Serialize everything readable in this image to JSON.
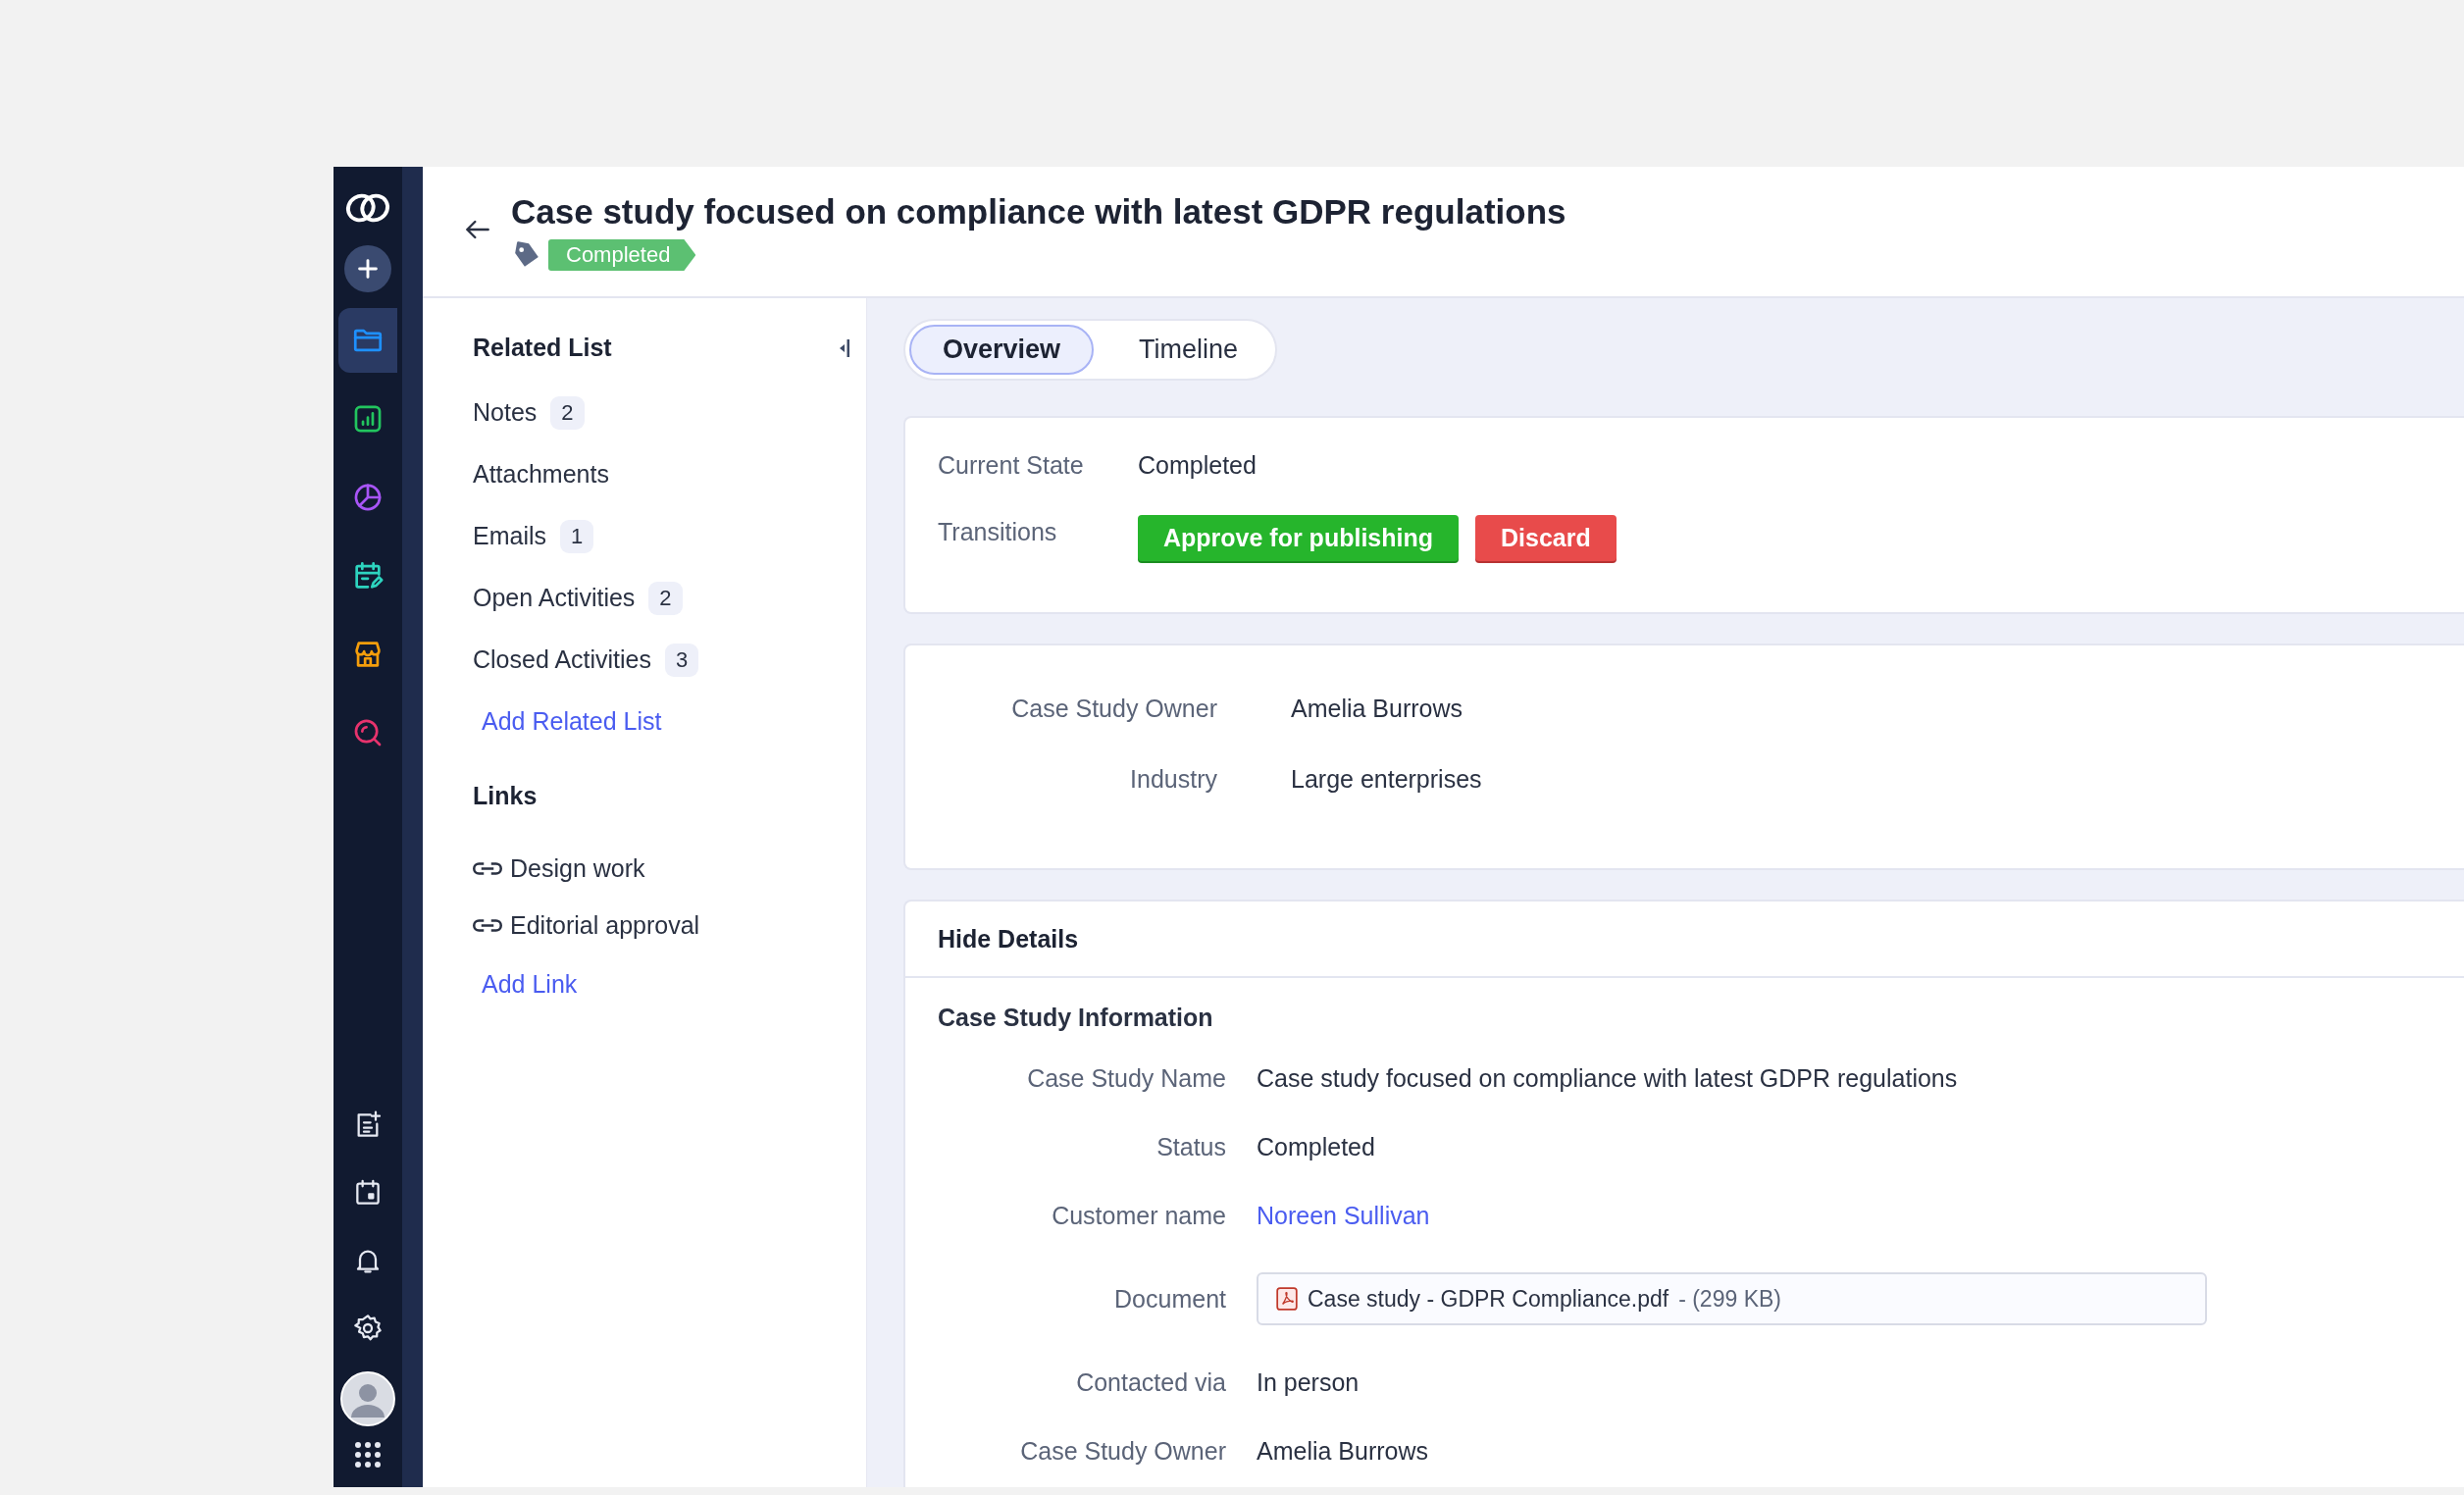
{
  "sidebar": {
    "top_items": [
      {
        "kind": "folder",
        "selected": true
      },
      {
        "kind": "chart",
        "selected": false
      },
      {
        "kind": "pie",
        "selected": false
      },
      {
        "kind": "calendar-edit",
        "selected": false
      },
      {
        "kind": "store",
        "selected": false
      },
      {
        "kind": "search",
        "selected": false
      }
    ],
    "bottom_items": [
      {
        "kind": "note-add"
      },
      {
        "kind": "calendar"
      },
      {
        "kind": "bell"
      },
      {
        "kind": "gear"
      }
    ]
  },
  "header": {
    "title": "Case study focused on compliance with latest GDPR regulations",
    "status": "Completed"
  },
  "related_list": {
    "title": "Related List",
    "items": [
      {
        "label": "Notes",
        "count": "2"
      },
      {
        "label": "Attachments"
      },
      {
        "label": "Emails",
        "count": "1"
      },
      {
        "label": "Open Activities",
        "count": "2"
      },
      {
        "label": "Closed Activities",
        "count": "3"
      }
    ],
    "add_label": "Add Related List"
  },
  "links": {
    "title": "Links",
    "items": [
      "Design work",
      "Editorial approval"
    ],
    "add_label": "Add Link"
  },
  "tabs": [
    {
      "label": "Overview",
      "selected": true
    },
    {
      "label": "Timeline",
      "selected": false
    }
  ],
  "state_card": {
    "current_state_label": "Current State",
    "current_state": "Completed",
    "transitions_label": "Transitions",
    "transitions": [
      {
        "label": "Approve for publishing",
        "kind": "approve"
      },
      {
        "label": "Discard",
        "kind": "discard"
      }
    ]
  },
  "summary_fields": [
    {
      "label": "Case Study Owner",
      "value": "Amelia Burrows"
    },
    {
      "label": "Industry",
      "value": "Large enterprises"
    }
  ],
  "details": {
    "toggle": "Hide Details",
    "section": "Case Study Information",
    "fields": [
      {
        "label": "Case Study Name",
        "value": "Case study focused on compliance with latest GDPR regulations",
        "kind": "text"
      },
      {
        "label": "Status",
        "value": "Completed",
        "kind": "text"
      },
      {
        "label": "Customer name",
        "value": "Noreen Sullivan",
        "kind": "link"
      },
      {
        "label": "Document",
        "value": "Case study - GDPR Compliance.pdf",
        "size": "- (299 KB)",
        "kind": "file"
      },
      {
        "label": "Contacted via",
        "value": "In person",
        "kind": "text"
      },
      {
        "label": "Case Study Owner",
        "value": "Amelia Burrows",
        "kind": "text"
      }
    ]
  }
}
